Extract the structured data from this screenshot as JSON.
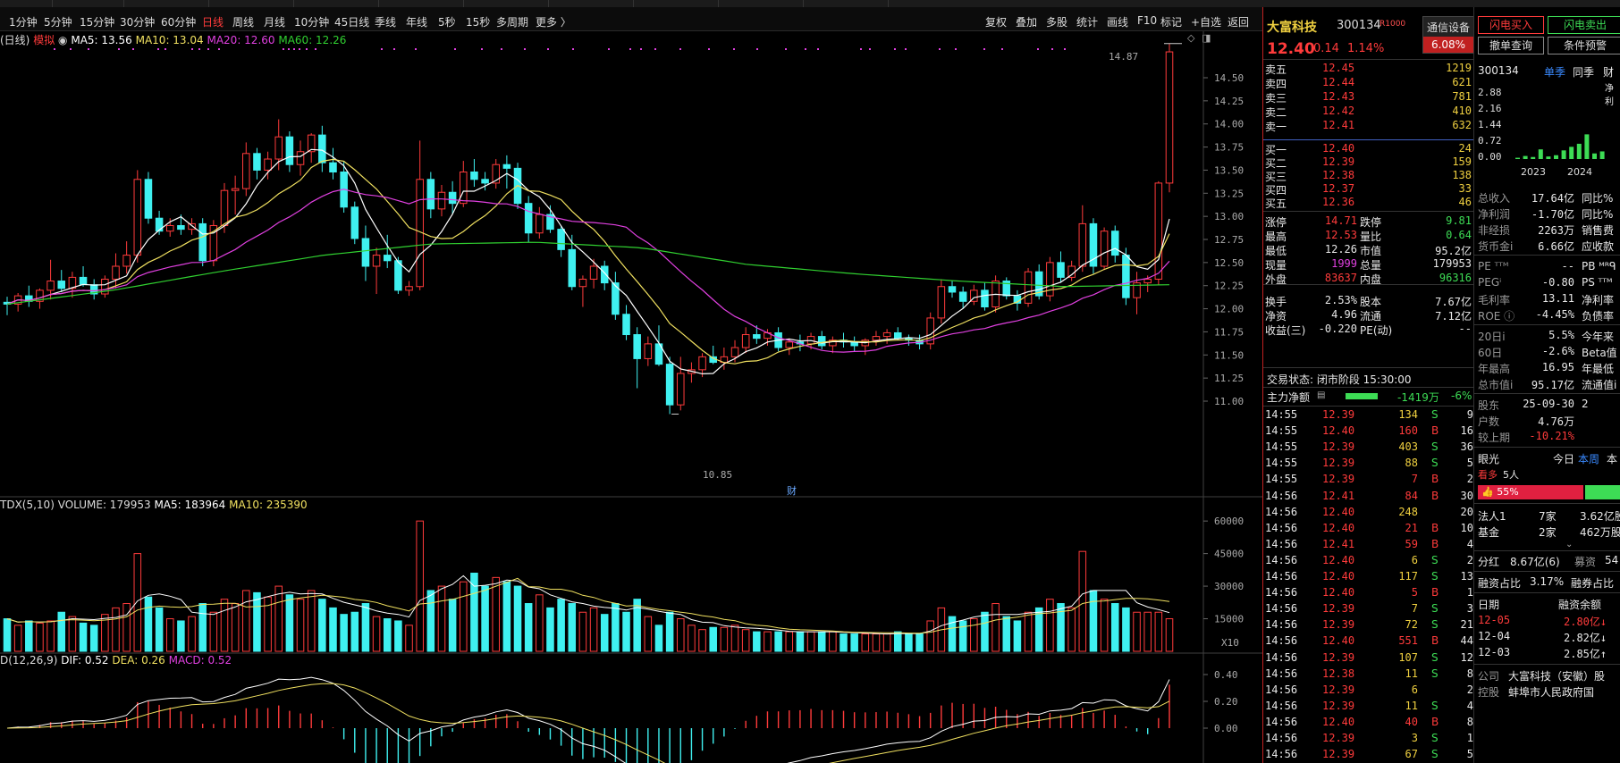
{
  "toolbar": {
    "periods": [
      "1分钟",
      "5分钟",
      "15分钟",
      "30分钟",
      "60分钟",
      "日线",
      "周线",
      "月线",
      "10分钟",
      "45日线",
      "季线",
      "年线",
      "5秒",
      "15秒",
      "多周期",
      "更多 〉"
    ],
    "active_period": "日线",
    "right_items": [
      "复权",
      "叠加",
      "多股",
      "统计",
      "画线",
      "F10",
      "标记",
      "+自选",
      "返回"
    ]
  },
  "main_chart": {
    "indicator_label": "(日线)",
    "sim_label": "模拟",
    "ma5": "MA5: 13.56",
    "ma10": "MA10: 13.04",
    "ma20": "MA20: 12.60",
    "ma60": "MA60: 12.26",
    "high_marker": "14.87",
    "low_marker": "10.85",
    "fin_marker": "财",
    "y_ticks": [
      "14.50",
      "14.25",
      "14.00",
      "13.75",
      "13.50",
      "13.25",
      "13.00",
      "12.75",
      "12.50",
      "12.25",
      "12.00",
      "11.75",
      "11.50",
      "11.25",
      "11.00"
    ],
    "colors": {
      "up": "#ff3b3b",
      "down": "#3ff0f0",
      "ma5": "#ffffff",
      "ma10": "#f0e060",
      "ma20": "#e040e0",
      "ma60": "#30d030"
    }
  },
  "volume_chart": {
    "label": "TDX(5,10)",
    "volume": "VOLUME: 179953",
    "ma5": "MA5: 183964",
    "ma10": "MA10: 235390",
    "y_ticks": [
      "60000",
      "45000",
      "30000",
      "15000"
    ],
    "unit": "X10"
  },
  "macd_chart": {
    "label": "D(12,26,9)",
    "dif": "DIF: 0.52",
    "dea": "DEA: 0.26",
    "macd": "MACD: 0.52",
    "y_ticks": [
      "0.40",
      "0.20",
      "0.00"
    ]
  },
  "quote": {
    "name": "大富科技",
    "code": "300134",
    "tag": "R1000",
    "sector": "通信设备",
    "sector_pct": "6.08%",
    "price": "12.40",
    "change": "0.14",
    "change_pct": "1.14%",
    "asks": [
      {
        "label": "卖五",
        "price": "12.45",
        "vol": "1219"
      },
      {
        "label": "卖四",
        "price": "12.44",
        "vol": "621"
      },
      {
        "label": "卖三",
        "price": "12.43",
        "vol": "781"
      },
      {
        "label": "卖二",
        "price": "12.42",
        "vol": "410"
      },
      {
        "label": "卖一",
        "price": "12.41",
        "vol": "632"
      }
    ],
    "bids": [
      {
        "label": "买一",
        "price": "12.40",
        "vol": "24"
      },
      {
        "label": "买二",
        "price": "12.39",
        "vol": "159"
      },
      {
        "label": "买三",
        "price": "12.38",
        "vol": "138"
      },
      {
        "label": "买四",
        "price": "12.37",
        "vol": "33"
      },
      {
        "label": "买五",
        "price": "12.36",
        "vol": "46"
      }
    ],
    "stats": [
      {
        "l1": "涨停",
        "v1": "14.71",
        "l2": "跌停",
        "v2": "9.81",
        "c1": "red",
        "c2": "green"
      },
      {
        "l1": "最高",
        "v1": "12.53",
        "l2": "量比",
        "v2": "0.64",
        "c1": "red",
        "c2": "green"
      },
      {
        "l1": "最低",
        "v1": "12.26",
        "l2": "市值",
        "v2": "95.2亿",
        "c1": "wht",
        "c2": "wht"
      },
      {
        "l1": "现量",
        "v1": "1999",
        "l2": "总量",
        "v2": "179953",
        "c1": "mag",
        "c2": "wht"
      },
      {
        "l1": "外盘",
        "v1": "83637",
        "l2": "内盘",
        "v2": "96316",
        "c1": "red",
        "c2": "green"
      },
      {
        "l1": "换手",
        "v1": "2.53%",
        "l2": "股本",
        "v2": "7.67亿",
        "c1": "wht",
        "c2": "wht"
      },
      {
        "l1": "净资",
        "v1": "4.96",
        "l2": "流通",
        "v2": "7.12亿",
        "c1": "wht",
        "c2": "wht"
      },
      {
        "l1": "收益(三)",
        "v1": "-0.220",
        "l2": "PE(动)",
        "v2": "--",
        "c1": "wht",
        "c2": "wht"
      }
    ],
    "trade_status": "交易状态: 闭市阶段 15:30:00",
    "main_flow_label": "主力净额",
    "main_flow_value": "-1419万",
    "main_flow_pct": "-6%",
    "ticks": [
      {
        "t": "14:55",
        "p": "12.39",
        "v": "134",
        "d": "S",
        "n": "9"
      },
      {
        "t": "14:55",
        "p": "12.40",
        "v": "160",
        "d": "B",
        "n": "16"
      },
      {
        "t": "14:55",
        "p": "12.39",
        "v": "403",
        "d": "S",
        "n": "36"
      },
      {
        "t": "14:55",
        "p": "12.39",
        "v": "88",
        "d": "S",
        "n": "5"
      },
      {
        "t": "14:55",
        "p": "12.39",
        "v": "7",
        "d": "B",
        "n": "2"
      },
      {
        "t": "14:56",
        "p": "12.41",
        "v": "84",
        "d": "B",
        "n": "30"
      },
      {
        "t": "14:56",
        "p": "12.40",
        "v": "248",
        "d": "",
        "n": "20"
      },
      {
        "t": "14:56",
        "p": "12.40",
        "v": "21",
        "d": "B",
        "n": "10"
      },
      {
        "t": "14:56",
        "p": "12.41",
        "v": "59",
        "d": "B",
        "n": "4"
      },
      {
        "t": "14:56",
        "p": "12.40",
        "v": "6",
        "d": "S",
        "n": "2"
      },
      {
        "t": "14:56",
        "p": "12.40",
        "v": "117",
        "d": "S",
        "n": "13"
      },
      {
        "t": "14:56",
        "p": "12.40",
        "v": "5",
        "d": "B",
        "n": "1"
      },
      {
        "t": "14:56",
        "p": "12.39",
        "v": "7",
        "d": "S",
        "n": "3"
      },
      {
        "t": "14:56",
        "p": "12.39",
        "v": "72",
        "d": "S",
        "n": "21"
      },
      {
        "t": "14:56",
        "p": "12.40",
        "v": "551",
        "d": "B",
        "n": "44"
      },
      {
        "t": "14:56",
        "p": "12.39",
        "v": "107",
        "d": "S",
        "n": "12"
      },
      {
        "t": "14:56",
        "p": "12.38",
        "v": "11",
        "d": "S",
        "n": "8"
      },
      {
        "t": "14:56",
        "p": "12.39",
        "v": "6",
        "d": "",
        "n": "2"
      },
      {
        "t": "14:56",
        "p": "12.39",
        "v": "11",
        "d": "S",
        "n": "4"
      },
      {
        "t": "14:56",
        "p": "12.40",
        "v": "40",
        "d": "B",
        "n": "8"
      },
      {
        "t": "14:56",
        "p": "12.39",
        "v": "3",
        "d": "S",
        "n": "1"
      },
      {
        "t": "14:56",
        "p": "12.39",
        "v": "67",
        "d": "S",
        "n": "5"
      }
    ]
  },
  "info": {
    "btn_flash_buy": "闪电买入",
    "btn_flash_sell": "闪电卖出",
    "btn_cancel_query": "撤单查询",
    "btn_cond_order": "条件预警",
    "code": "300134",
    "tab_single": "单季",
    "tab_same": "同季",
    "tab_fin": "财",
    "net_label": "净利",
    "bar_y": [
      "2.88",
      "2.16",
      "1.44",
      "0.72",
      "0.00"
    ],
    "bar_x": [
      "2023",
      "2024"
    ],
    "bar_values": [
      0.05,
      0.12,
      0.08,
      0.38,
      0.1,
      0.15,
      0.34,
      0.48,
      0.6,
      0.97,
      0.22,
      0.3
    ],
    "rows_a": [
      {
        "l": "总收入",
        "v": "17.64亿",
        "r": "同比%"
      },
      {
        "l": "净利润",
        "v": "-1.70亿",
        "r": "同比%"
      },
      {
        "l": "非经损",
        "v": "2263万",
        "r": "销售费"
      },
      {
        "l": "货币金i",
        "v": "6.66亿",
        "r": "应收款"
      }
    ],
    "rows_b": [
      {
        "l": "PE ᵀᵀᴹ",
        "v": "--",
        "r": "PB ᴹᴿᑫ"
      },
      {
        "l": "PEGⁱ",
        "v": "-0.80",
        "r": "PS ᵀᵀᴹ"
      },
      {
        "l": "毛利率",
        "v": "13.11",
        "r": "净利率"
      },
      {
        "l": "ROE ⓘ",
        "v": "-4.45%",
        "r": "负债率"
      }
    ],
    "rows_c": [
      {
        "l": "20日i",
        "v": "5.5%",
        "r": "今年来"
      },
      {
        "l": "60日",
        "v": "-2.6%",
        "r": "Beta值"
      },
      {
        "l": "年最高",
        "v": "16.95",
        "r": "年最低"
      },
      {
        "l": "总市值i",
        "v": "95.17亿",
        "r": "流通值i"
      }
    ],
    "holders": [
      {
        "l": "股东",
        "v": "25-09-30",
        "r": "2"
      },
      {
        "l": "户数",
        "v": "4.76万",
        "r": ""
      },
      {
        "l": "较上期",
        "v": "-10.21%",
        "r": ""
      }
    ],
    "eye_label": "眼光",
    "eye_today": "今日",
    "eye_week": "本周",
    "eye_month": "本",
    "bull_label": "看多",
    "bull_count": "5人",
    "bull_pct": "55%",
    "inst": [
      {
        "l": "法人1",
        "v": "7家",
        "r": "3.62亿股"
      },
      {
        "l": "基金",
        "v": "2家",
        "r": "462万股"
      }
    ],
    "div_label": "分红",
    "div_value": "8.67亿(6)",
    "raise_label": "募资",
    "raise_value": "54",
    "margin_label": "融资占比",
    "margin_value": "3.17%",
    "short_label": "融券占比",
    "margin_date_h": "日期",
    "margin_bal_h": "融资余额",
    "margin_rows": [
      {
        "d": "12-05",
        "v": "2.80亿↓"
      },
      {
        "d": "12-04",
        "v": "2.82亿↓"
      },
      {
        "d": "12-03",
        "v": "2.85亿↑"
      }
    ],
    "company_label": "公司",
    "company_value": "大富科技（安徽）股",
    "ctrl_label": "控股",
    "ctrl_value": "蚌埠市人民政府国"
  }
}
